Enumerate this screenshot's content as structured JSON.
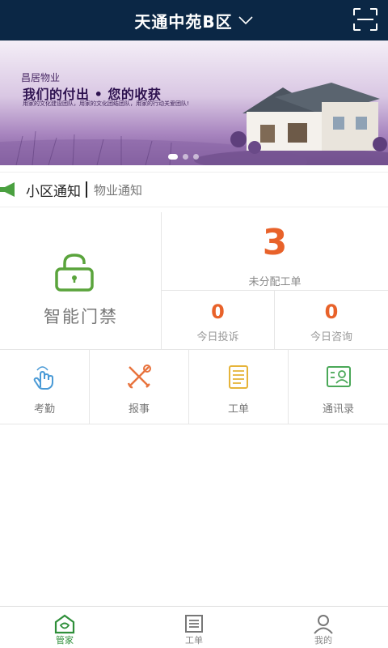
{
  "header": {
    "title": "天通中苑B区",
    "dropdown_icon": "chevron-down-icon",
    "scan_icon": "scan-icon"
  },
  "banner": {
    "brand": "昌居物业",
    "slogan": "我们的付出 • 您的收获",
    "subtitle": "用家的文化建设团队，用家的文化团结团队，用家的行动关爱团队!",
    "slides_total": 3,
    "active_slide": 1
  },
  "notice": {
    "title": "小区通知",
    "text": "物业通知",
    "icon": "megaphone-icon"
  },
  "door_access": {
    "label": "智能门禁",
    "icon": "unlock-icon",
    "icon_color": "#5aa43c"
  },
  "stats": {
    "unassigned": {
      "value": "3",
      "label": "未分配工单"
    },
    "complaints_today": {
      "value": "0",
      "label": "今日投诉"
    },
    "consults_today": {
      "value": "0",
      "label": "今日咨询"
    },
    "accent_color": "#e8622a"
  },
  "shortcuts": [
    {
      "label": "考勤",
      "icon": "touch-hand-icon",
      "color": "#4a9ad6"
    },
    {
      "label": "报事",
      "icon": "tools-icon",
      "color": "#e8733d"
    },
    {
      "label": "工单",
      "icon": "document-list-icon",
      "color": "#e6b43a"
    },
    {
      "label": "通讯录",
      "icon": "contact-card-icon",
      "color": "#4aa858"
    }
  ],
  "tabbar": [
    {
      "label": "管家",
      "icon": "house-icon",
      "active": true
    },
    {
      "label": "工单",
      "icon": "list-icon",
      "active": false
    },
    {
      "label": "我的",
      "icon": "user-icon",
      "active": false
    }
  ]
}
